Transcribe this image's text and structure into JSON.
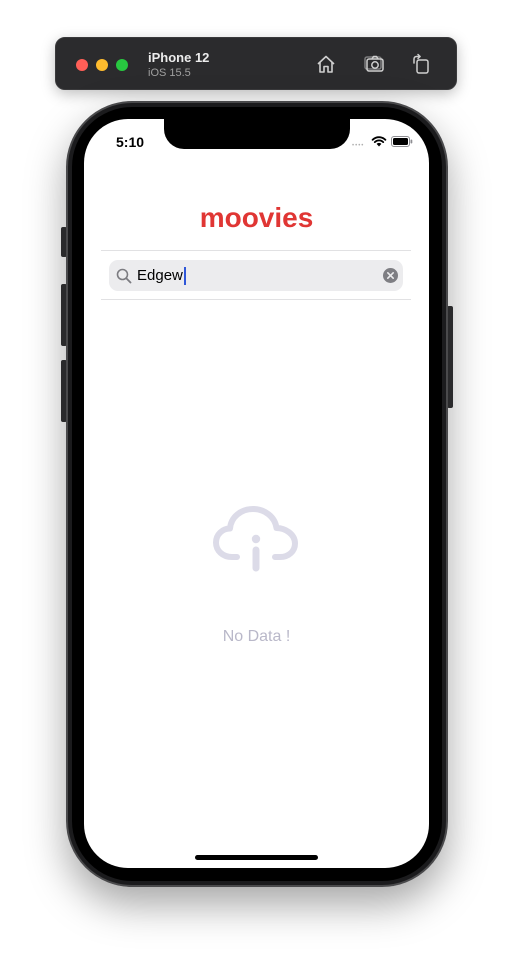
{
  "simulator": {
    "device_name": "iPhone 12",
    "os_version": "iOS 15.5",
    "toolbar_icons": [
      "home-icon",
      "screenshot-icon",
      "rotate-icon"
    ]
  },
  "status_bar": {
    "time": "5:10",
    "icons": [
      "signal-icon",
      "wifi-icon",
      "battery-icon"
    ]
  },
  "app": {
    "title": "moovies",
    "accent_color": "#e03634"
  },
  "search": {
    "value": "Edgew",
    "icon": "search-icon",
    "clear_icon": "clear-icon"
  },
  "empty_state": {
    "icon": "cloud-info-icon",
    "message": "No Data !",
    "color": "#b9b8c9"
  }
}
